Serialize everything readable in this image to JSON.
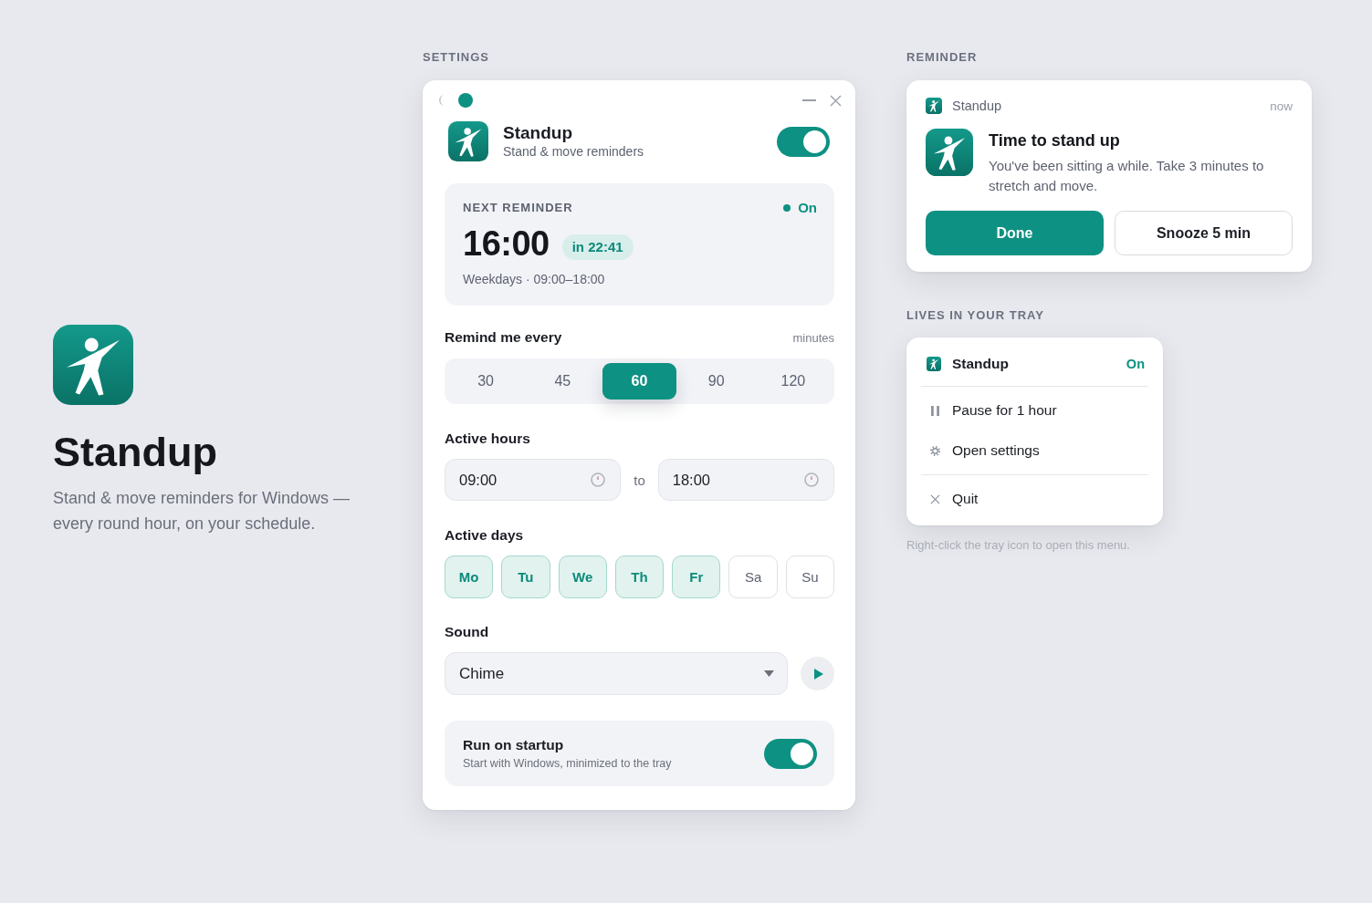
{
  "hero": {
    "title": "Standup",
    "tagline": "Stand & move reminders for Windows — every round hour, on your schedule."
  },
  "settings": {
    "section_label": "SETTINGS",
    "window": {
      "title": "Standup",
      "subtitle": "Stand & move reminders",
      "enabled": true
    },
    "next_reminder": {
      "label": "NEXT REMINDER",
      "status": "On",
      "time": "16:00",
      "countdown": "in 22:41",
      "schedule": "Weekdays · 09:00–18:00"
    },
    "interval": {
      "label": "Remind me every",
      "unit": "minutes",
      "options": [
        {
          "label": "30",
          "selected": false
        },
        {
          "label": "45",
          "selected": false
        },
        {
          "label": "60",
          "selected": true
        },
        {
          "label": "90",
          "selected": false
        },
        {
          "label": "120",
          "selected": false
        }
      ]
    },
    "active_hours": {
      "label": "Active hours",
      "from": "09:00",
      "separator": "to",
      "to": "18:00"
    },
    "active_days": {
      "label": "Active days",
      "days": [
        {
          "label": "Mo",
          "selected": true
        },
        {
          "label": "Tu",
          "selected": true
        },
        {
          "label": "We",
          "selected": true
        },
        {
          "label": "Th",
          "selected": true
        },
        {
          "label": "Fr",
          "selected": true
        },
        {
          "label": "Sa",
          "selected": false
        },
        {
          "label": "Su",
          "selected": false
        }
      ]
    },
    "sound": {
      "label": "Sound",
      "value": "Chime"
    },
    "run_on_startup": {
      "title": "Run on startup",
      "description": "Start with Windows, minimized to the tray",
      "on": true
    }
  },
  "reminder": {
    "section_label": "REMINDER",
    "app": "Standup",
    "time": "now",
    "title": "Time to stand up",
    "body": "You've been sitting a while. Take 3 minutes to stretch and move.",
    "buttons": [
      {
        "label": "Done",
        "kind": "primary"
      },
      {
        "label": "Snooze 5 min",
        "kind": "secondary"
      }
    ]
  },
  "tray": {
    "section_label": "LIVES IN YOUR TRAY",
    "app": "Standup",
    "status": "On",
    "groups": [
      {
        "items": [
          {
            "label": "Pause for 1 hour",
            "kind": "pause"
          },
          {
            "label": "Open settings",
            "kind": "settings"
          }
        ]
      },
      {
        "items": [
          {
            "label": "Quit",
            "kind": "quit"
          }
        ]
      }
    ],
    "caption": "Right-click the tray icon to open this menu."
  }
}
